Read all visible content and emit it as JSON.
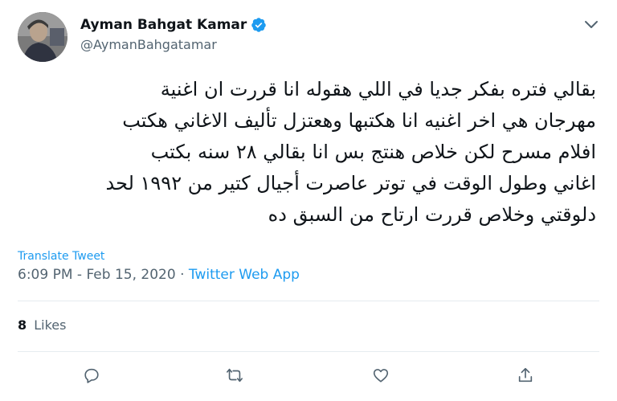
{
  "author": {
    "name": "Ayman Bahgat Kamar",
    "handle": "@AymanBahgatamar",
    "verified": true,
    "avatar_icon": "profile-photo"
  },
  "tweet": {
    "lines": [
      "بقالي فتره بفكر جديا في اللي هقوله انا قررت ان اغنية",
      "مهرجان هي اخر اغنيه انا هكتبها وهعتزل تأليف الاغاني هكتب",
      "افلام مسرح لكن خلاص هنتج بس انا بقالي ٢٨ سنه بكتب",
      "اغاني وطول الوقت في توتر عاصرت أجيال كتير من ١٩٩٢ لحد",
      "دلوقتي وخلاص قررت ارتاح من السبق ده"
    ],
    "translate_label": "Translate Tweet",
    "time": "6:09 PM",
    "date": "Feb 15, 2020",
    "separator": "·",
    "source": "Twitter Web App"
  },
  "stats": {
    "likes_count": "8",
    "likes_label": "Likes"
  },
  "actions": [
    {
      "name": "reply",
      "icon": "speech-bubble-icon"
    },
    {
      "name": "retweet",
      "icon": "retweet-icon"
    },
    {
      "name": "like",
      "icon": "heart-icon"
    },
    {
      "name": "share",
      "icon": "share-icon"
    }
  ],
  "colors": {
    "accent": "#1d9bf0",
    "text": "#0f1419",
    "secondary": "#536471",
    "divider": "#e6ecf0"
  }
}
